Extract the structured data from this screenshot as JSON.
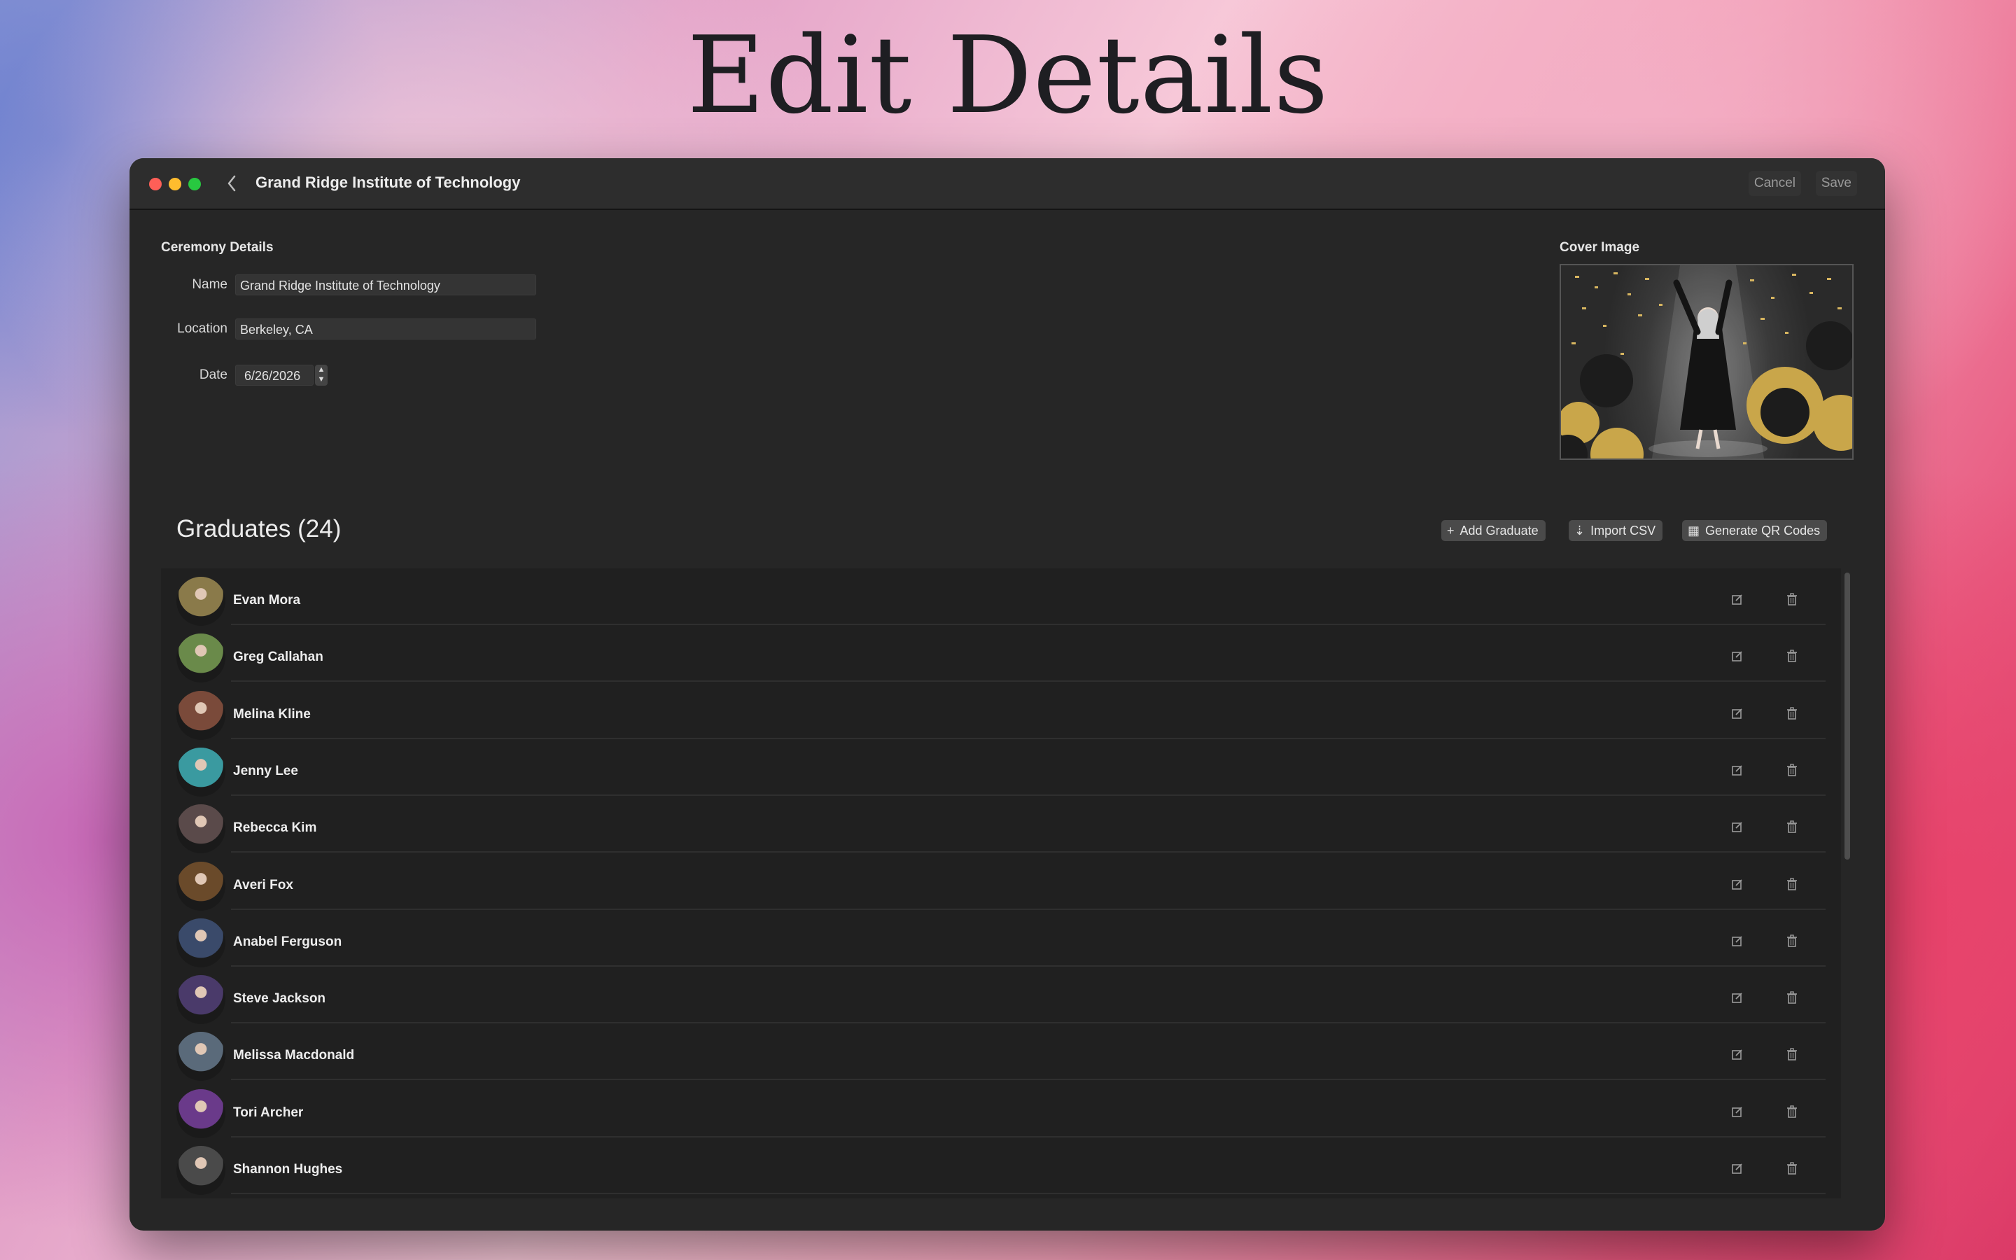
{
  "page": {
    "heading": "Edit Details"
  },
  "window": {
    "title": "Grand Ridge Institute of Technology",
    "cancel_label": "Cancel",
    "save_label": "Save"
  },
  "ceremony": {
    "section_label": "Ceremony Details",
    "name_label": "Name",
    "name_value": "Grand Ridge Institute of Technology",
    "location_label": "Location",
    "location_value": "Berkeley, CA",
    "date_label": "Date",
    "date_value": "6/26/2026"
  },
  "cover": {
    "label": "Cover Image"
  },
  "graduates": {
    "title": "Graduates (24)",
    "add_label": "Add Graduate",
    "import_label": "Import CSV",
    "qr_label": "Generate QR Codes",
    "items": [
      {
        "name": "Evan Mora",
        "color": "#8a7a4a"
      },
      {
        "name": "Greg Callahan",
        "color": "#6a8a4a"
      },
      {
        "name": "Melina Kline",
        "color": "#7a4a3a"
      },
      {
        "name": "Jenny Lee",
        "color": "#3a9aa0"
      },
      {
        "name": "Rebecca Kim",
        "color": "#5a4a4a"
      },
      {
        "name": "Averi Fox",
        "color": "#6a4a2a"
      },
      {
        "name": "Anabel Ferguson",
        "color": "#3a4a6a"
      },
      {
        "name": "Steve Jackson",
        "color": "#4a3a6a"
      },
      {
        "name": "Melissa Macdonald",
        "color": "#5a6a7a"
      },
      {
        "name": "Tori Archer",
        "color": "#6a3a8a"
      },
      {
        "name": "Shannon Hughes",
        "color": "#4a4a4a"
      }
    ]
  }
}
